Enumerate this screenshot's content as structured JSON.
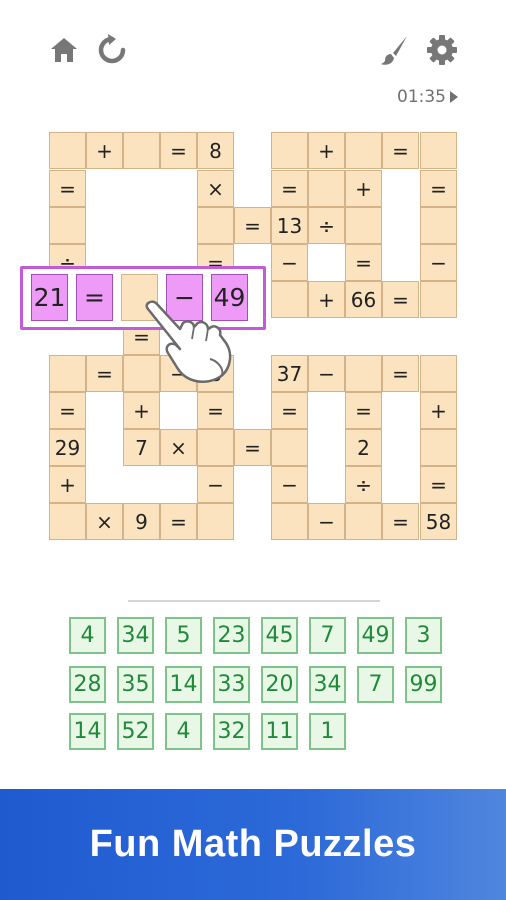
{
  "topbar": {
    "home_icon": "home-icon",
    "restart_icon": "restart-icon",
    "theme_icon": "paintbrush-icon",
    "settings_icon": "gear-icon",
    "timer": "01:35",
    "timer_icon": "play-icon"
  },
  "grid": {
    "cells": [
      {
        "r": 0,
        "c": 0,
        "t": ""
      },
      {
        "r": 0,
        "c": 1,
        "t": "+"
      },
      {
        "r": 0,
        "c": 2,
        "t": ""
      },
      {
        "r": 0,
        "c": 3,
        "t": "="
      },
      {
        "r": 0,
        "c": 4,
        "t": "8"
      },
      {
        "r": 0,
        "c": 6,
        "t": ""
      },
      {
        "r": 0,
        "c": 7,
        "t": "+"
      },
      {
        "r": 0,
        "c": 8,
        "t": ""
      },
      {
        "r": 0,
        "c": 9,
        "t": "="
      },
      {
        "r": 0,
        "c": 10,
        "t": ""
      },
      {
        "r": 1,
        "c": 0,
        "t": "="
      },
      {
        "r": 1,
        "c": 4,
        "t": "×"
      },
      {
        "r": 1,
        "c": 6,
        "t": "="
      },
      {
        "r": 1,
        "c": 7,
        "t": ""
      },
      {
        "r": 1,
        "c": 8,
        "t": "+"
      },
      {
        "r": 1,
        "c": 10,
        "t": "="
      },
      {
        "r": 2,
        "c": 0,
        "t": ""
      },
      {
        "r": 2,
        "c": 4,
        "t": ""
      },
      {
        "r": 2,
        "c": 5,
        "t": "="
      },
      {
        "r": 2,
        "c": 6,
        "t": "13"
      },
      {
        "r": 2,
        "c": 7,
        "t": "÷"
      },
      {
        "r": 2,
        "c": 8,
        "t": ""
      },
      {
        "r": 2,
        "c": 10,
        "t": ""
      },
      {
        "r": 3,
        "c": 0,
        "t": "÷"
      },
      {
        "r": 3,
        "c": 4,
        "t": "="
      },
      {
        "r": 3,
        "c": 6,
        "t": "−"
      },
      {
        "r": 3,
        "c": 8,
        "t": "="
      },
      {
        "r": 3,
        "c": 10,
        "t": "−"
      },
      {
        "r": 4,
        "c": 6,
        "t": ""
      },
      {
        "r": 4,
        "c": 7,
        "t": "+"
      },
      {
        "r": 4,
        "c": 8,
        "t": "66"
      },
      {
        "r": 4,
        "c": 9,
        "t": "="
      },
      {
        "r": 4,
        "c": 10,
        "t": ""
      },
      {
        "r": 5,
        "c": 2,
        "t": "="
      },
      {
        "r": 6,
        "c": 0,
        "t": ""
      },
      {
        "r": 6,
        "c": 1,
        "t": "="
      },
      {
        "r": 6,
        "c": 2,
        "t": ""
      },
      {
        "r": 6,
        "c": 3,
        "t": "−"
      },
      {
        "r": 6,
        "c": 4,
        "t": "8"
      },
      {
        "r": 6,
        "c": 6,
        "t": "37"
      },
      {
        "r": 6,
        "c": 7,
        "t": "−"
      },
      {
        "r": 6,
        "c": 8,
        "t": ""
      },
      {
        "r": 6,
        "c": 9,
        "t": "="
      },
      {
        "r": 6,
        "c": 10,
        "t": ""
      },
      {
        "r": 7,
        "c": 0,
        "t": "="
      },
      {
        "r": 7,
        "c": 2,
        "t": "+"
      },
      {
        "r": 7,
        "c": 4,
        "t": "="
      },
      {
        "r": 7,
        "c": 6,
        "t": "="
      },
      {
        "r": 7,
        "c": 8,
        "t": "="
      },
      {
        "r": 7,
        "c": 10,
        "t": "+"
      },
      {
        "r": 8,
        "c": 0,
        "t": "29"
      },
      {
        "r": 8,
        "c": 2,
        "t": "7"
      },
      {
        "r": 8,
        "c": 3,
        "t": "×"
      },
      {
        "r": 8,
        "c": 4,
        "t": ""
      },
      {
        "r": 8,
        "c": 5,
        "t": "="
      },
      {
        "r": 8,
        "c": 6,
        "t": ""
      },
      {
        "r": 8,
        "c": 8,
        "t": "2"
      },
      {
        "r": 8,
        "c": 10,
        "t": ""
      },
      {
        "r": 9,
        "c": 0,
        "t": "+"
      },
      {
        "r": 9,
        "c": 4,
        "t": "−"
      },
      {
        "r": 9,
        "c": 6,
        "t": "−"
      },
      {
        "r": 9,
        "c": 8,
        "t": "÷"
      },
      {
        "r": 9,
        "c": 10,
        "t": "="
      },
      {
        "r": 10,
        "c": 0,
        "t": ""
      },
      {
        "r": 10,
        "c": 1,
        "t": "×"
      },
      {
        "r": 10,
        "c": 2,
        "t": "9"
      },
      {
        "r": 10,
        "c": 3,
        "t": "="
      },
      {
        "r": 10,
        "c": 4,
        "t": ""
      },
      {
        "r": 10,
        "c": 6,
        "t": ""
      },
      {
        "r": 10,
        "c": 7,
        "t": "−"
      },
      {
        "r": 10,
        "c": 8,
        "t": ""
      },
      {
        "r": 10,
        "c": 9,
        "t": "="
      },
      {
        "r": 10,
        "c": 10,
        "t": "58"
      }
    ]
  },
  "active_row": [
    "21",
    "=",
    "",
    "−",
    "49"
  ],
  "hand_icon": "pointing-hand-icon",
  "tiles": [
    "4",
    "34",
    "5",
    "23",
    "45",
    "7",
    "49",
    "3",
    "28",
    "35",
    "14",
    "33",
    "20",
    "34",
    "7",
    "99",
    "14",
    "52",
    "4",
    "32",
    "11",
    "1"
  ],
  "banner": {
    "text": "Fun Math Puzzles"
  }
}
